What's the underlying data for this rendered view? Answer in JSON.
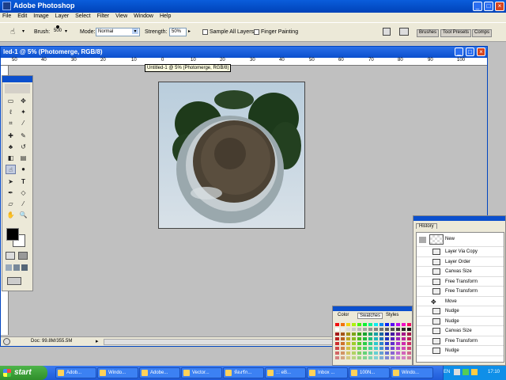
{
  "app": {
    "title": "Adobe Photoshop"
  },
  "menu": [
    "File",
    "Edit",
    "Image",
    "Layer",
    "Select",
    "Filter",
    "View",
    "Window",
    "Help"
  ],
  "options": {
    "brush_label": "Brush:",
    "brush_size": "500",
    "mode_label": "Mode:",
    "mode_value": "Normal",
    "strength_label": "Strength:",
    "strength_value": "50%",
    "sample_all_layers": "Sample All Layers",
    "finger_painting": "Finger Painting",
    "panel_tabs": [
      "Brushes",
      "Tool Presets",
      "Comps"
    ]
  },
  "document": {
    "title": "led-1 @ 5% (Photomerge, RGB/8)",
    "tooltip": "Untitled-1 @ 5% (Photomerge, RGB/8)",
    "ruler_ticks": [
      "50",
      "40",
      "30",
      "20",
      "10",
      "0",
      "10",
      "20",
      "30",
      "40",
      "50",
      "60",
      "70",
      "80",
      "90",
      "100"
    ],
    "status": "Doc: 99.8M/355.5M"
  },
  "history": {
    "tab": "History",
    "snapshot": "New",
    "items": [
      "Layer Via Copy",
      "Layer Order",
      "Canvas Size",
      "Free Transform",
      "Free Transform",
      "Move",
      "Nudge",
      "Nudge",
      "Canvas Size",
      "Free Transform",
      "Nudge"
    ]
  },
  "swatches": {
    "tabs": [
      "Color",
      "Swatches",
      "Styles"
    ]
  },
  "taskbar": {
    "start": "start",
    "tasks": [
      "Adob...",
      "Windo...",
      "Adobe...",
      "Vector...",
      "ห้องรัก...",
      "::: eB...",
      "Inbox ...",
      "100N...",
      "Windo..."
    ],
    "lang": "EN",
    "clock": "17:10"
  },
  "colors": {
    "titlebar": "#0a5ddb",
    "doc_title": "#2a6fe8",
    "taskbar": "#1f5bd8",
    "start": "#3f9f3a"
  }
}
